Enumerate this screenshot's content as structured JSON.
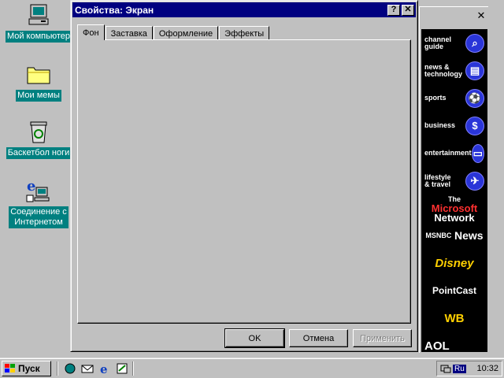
{
  "desktop": {
    "icons": [
      {
        "label": "Мой компьютер",
        "icon": "computer-icon"
      },
      {
        "label": "Мои мемы",
        "icon": "folder-icon"
      },
      {
        "label": "Баскетбол ноги",
        "icon": "recycle-bin-icon"
      },
      {
        "label": "Соединение с Интернетом",
        "line1": "Соединение с",
        "line2": "Интернетом",
        "icon": "internet-connection-icon"
      }
    ]
  },
  "dialog": {
    "title": "Свойства: Экран",
    "help_button": "?",
    "close_button": "✕",
    "tabs": [
      "Фон",
      "Заставка",
      "Оформление",
      "Эффекты"
    ],
    "active_tab": 0,
    "buttons": {
      "ok": "OK",
      "cancel": "Отмена",
      "apply": "Применить"
    }
  },
  "channel_bar": {
    "close": "✕",
    "channels": [
      {
        "label_a": "channel",
        "label_b": "guide",
        "icon": "channel-guide-icon"
      },
      {
        "label_a": "news &",
        "label_b": "technology",
        "icon": "news-icon"
      },
      {
        "label_a": "sports",
        "label_b": "",
        "icon": "sports-icon"
      },
      {
        "label_a": "business",
        "label_b": "",
        "icon": "business-icon"
      },
      {
        "label_a": "entertainment",
        "label_b": "",
        "icon": "entertainment-icon"
      },
      {
        "label_a": "lifestyle",
        "label_b": "& travel",
        "icon": "travel-icon"
      }
    ],
    "logos": [
      {
        "line1": "The",
        "line2": "Microsoft",
        "line3": "Network"
      },
      {
        "left": "MSNBC",
        "right": "News"
      },
      {
        "text": "Disney"
      },
      {
        "text": "PointCast"
      },
      {
        "text": "WB"
      },
      {
        "text": "AOL"
      }
    ]
  },
  "taskbar": {
    "start_label": "Пуск",
    "quick_launch": [
      "desktop-icon",
      "outlook-icon",
      "ie-icon",
      "channels-icon"
    ],
    "lang": "Ru",
    "clock": "10:32"
  }
}
